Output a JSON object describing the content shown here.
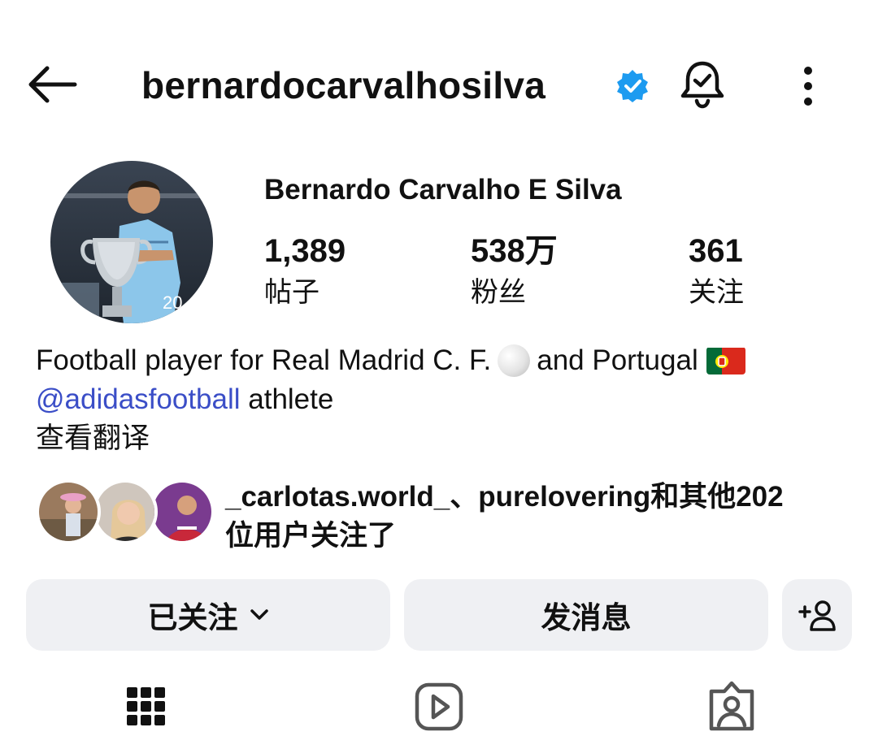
{
  "header": {
    "username": "bernardocarvalhosilva",
    "icons": [
      "back-arrow-icon",
      "verified-badge-icon",
      "bell-check-icon",
      "more-vertical-icon"
    ]
  },
  "profile": {
    "full_name": "Bernardo Carvalho E Silva",
    "stats": [
      {
        "value": "1,389",
        "label": "帖子"
      },
      {
        "value": "538万",
        "label": "粉丝"
      },
      {
        "value": "361",
        "label": "关注"
      }
    ]
  },
  "bio": {
    "line1": "Football player for Real Madrid C. F.",
    "line1_mid": "and Portugal",
    "mention": "@adidasfootball",
    "line2_rest": " athlete",
    "translate": "查看翻译"
  },
  "followed_by": {
    "line1": "_carlotas.world_、purelovering和其他202",
    "line2": "位用户关注了"
  },
  "actions": {
    "following_label": "已关注",
    "message_label": "发消息"
  },
  "tabs": [
    "grid-icon",
    "reels-icon",
    "tagged-icon"
  ],
  "colors": {
    "verified": "#1d9bf0",
    "mention": "#3b4ec7",
    "button_bg": "#eff0f3"
  }
}
